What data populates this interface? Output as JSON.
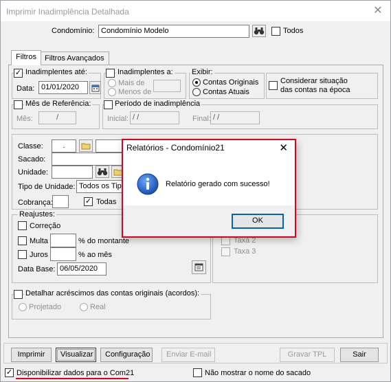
{
  "window": {
    "title": "Imprimir Inadimplência Detalhada"
  },
  "header": {
    "condominio_label": "Condomínio:",
    "condominio_value": "Condomínio Modelo",
    "todos_label": "Todos"
  },
  "tabs": [
    {
      "label": "Filtros"
    },
    {
      "label": "Filtros Avançados"
    }
  ],
  "filters": {
    "inadimplentes_ate_label": "Inadimplentes até:",
    "data_label": "Data:",
    "data_value": "01/01/2020",
    "inadimplentes_a_label": "Inadimplentes a:",
    "mais_de_label": "Mais de",
    "menos_de_label": "Menos de",
    "exibir_label": "Exibir:",
    "contas_originais_label": "Contas Originais",
    "contas_atuais_label": "Contas Atuais",
    "considerar_label_1": "Considerar situação",
    "considerar_label_2": "das contas na época",
    "mes_referencia_label": "Mês de Referência:",
    "mes_label": "Mês:",
    "mes_value": "/",
    "periodo_label": "Período de inadimplência",
    "inicial_label": "Inicial:",
    "inicial_value": "/ /",
    "final_label": "Final:",
    "final_value": "/ /"
  },
  "details": {
    "classe_label": "Classe:",
    "classe_value": ".",
    "sacado_label": "Sacado:",
    "unidade_label": "Unidade:",
    "tipo_unidade_label": "Tipo de Unidade:",
    "tipo_unidade_value": "Todos os Tipo",
    "cobranca_label": "Cobrança:",
    "todas_label": "Todas"
  },
  "reajustes": {
    "legend": "Reajustes:",
    "correcao_label": "Correção",
    "multa_label": "Multa",
    "multa_suffix": "% do montante",
    "juros_label": "Juros",
    "juros_suffix": "% ao mês",
    "data_base_label": "Data Base:",
    "data_base_value": "06/05/2020",
    "taxa2_label": "Taxa 2",
    "taxa3_label": "Taxa 3"
  },
  "acordos": {
    "label": "Detalhar acréscimos das contas originais (acordos):",
    "projetado_label": "Projetado",
    "real_label": "Real"
  },
  "buttons": {
    "imprimir": "Imprimir",
    "visualizar": "Visualizar",
    "configuracao": "Configuração",
    "enviar_email": "Enviar E-mail",
    "gravar_tpl": "Gravar TPL",
    "sair": "Sair"
  },
  "footer": {
    "disponibilizar_label": "Disponibilizar dados para o Com21",
    "nao_mostrar_label": "Não mostrar o nome do sacado"
  },
  "dialog": {
    "title": "Relatórios - Condomínio21",
    "message": "Relatório gerado com sucesso!",
    "ok_label": "OK",
    "close_glyph": "✕"
  },
  "colors": {
    "accent_red": "#e0001a",
    "info_blue": "#1f5fbf"
  }
}
